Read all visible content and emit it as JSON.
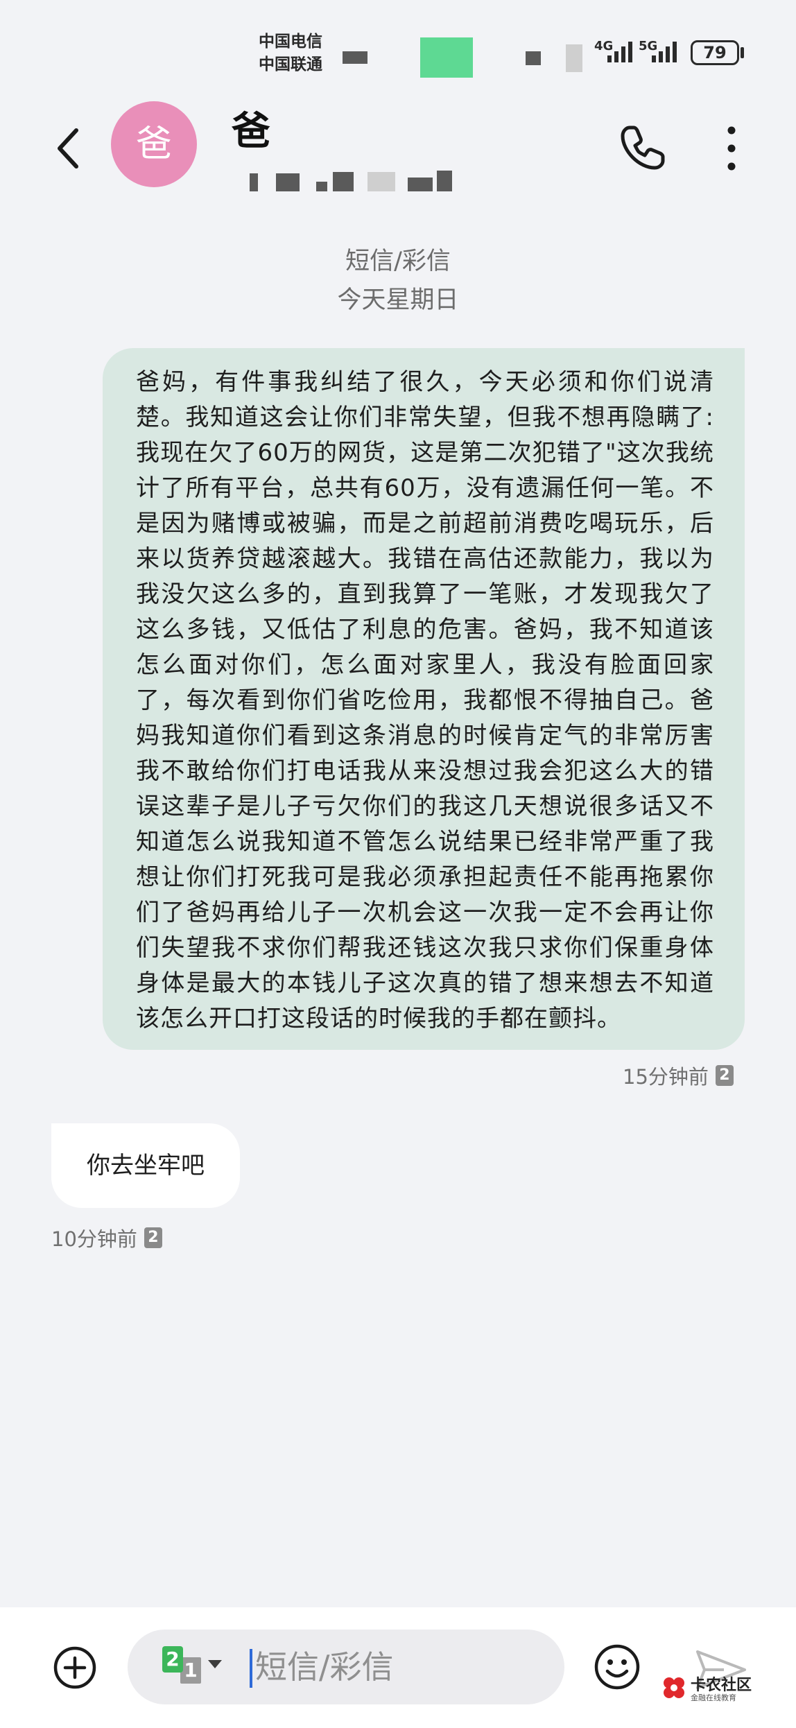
{
  "status_bar": {
    "carrier_1": "中国电信",
    "carrier_2": "中国联通",
    "network_1": "4G",
    "network_2": "5G",
    "battery": "79"
  },
  "header": {
    "avatar_text": "爸",
    "contact_name": "爸"
  },
  "conversation": {
    "channel_label": "短信/彩信",
    "date_label": "今天星期日",
    "messages": [
      {
        "direction": "outgoing",
        "text": "爸妈，有件事我纠结了很久，今天必须和你们说清楚。我知道这会让你们非常失望，但我不想再隐瞒了:我现在欠了60万的网货，这是第二次犯错了\"这次我统计了所有平台，总共有60万，没有遗漏任何一笔。不是因为赌博或被骗，而是之前超前消费吃喝玩乐，后来以货养贷越滚越大。我错在高估还款能力，我以为我没欠这么多的，直到我算了一笔账，才发现我欠了这么多钱，又低估了利息的危害。爸妈，我不知道该怎么面对你们，怎么面对家里人，我没有脸面回家了，每次看到你们省吃俭用，我都恨不得抽自己。爸妈我知道你们看到这条消息的时候肯定气的非常厉害我不敢给你们打电话我从来没想过我会犯这么大的错误这辈子是儿子亏欠你们的我这几天想说很多话又不知道怎么说我知道不管怎么说结果已经非常严重了我想让你们打死我可是我必须承担起责任不能再拖累你们了爸妈再给儿子一次机会这一次我一定不会再让你们失望我不求你们帮我还钱这次我只求你们保重身体身体是最大的本钱儿子这次真的错了想来想去不知道该怎么开口打这段话的时候我的手都在颤抖。",
        "time": "15分钟前",
        "sim": "2"
      },
      {
        "direction": "incoming",
        "text": "你去坐牢吧",
        "time": "10分钟前",
        "sim": "2"
      }
    ]
  },
  "input_bar": {
    "sim_primary": "2",
    "sim_secondary": "1",
    "placeholder": "短信/彩信"
  },
  "watermark": {
    "title": "卡农社区",
    "subtitle": "金融在线教育"
  },
  "colors": {
    "background": "#f2f3f6",
    "outgoing_bubble": "#d9e8e2",
    "incoming_bubble": "#ffffff",
    "avatar": "#e98fb9",
    "accent_sim": "#3cb65a"
  },
  "icons": {
    "back": "chevron-left-icon",
    "phone": "phone-icon",
    "more": "more-vertical-icon",
    "add": "plus-circle-icon",
    "emoji": "emoji-icon",
    "send": "send-icon"
  }
}
